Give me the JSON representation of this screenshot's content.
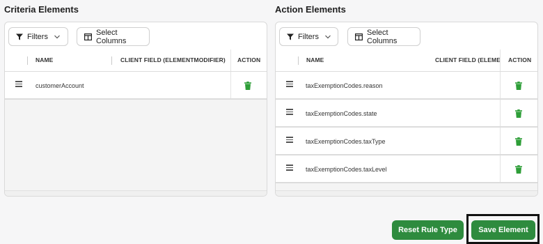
{
  "criteria": {
    "title": "Criteria Elements",
    "filters_label": "Filters",
    "select_columns_label": "Select Columns",
    "columns": {
      "name": "NAME",
      "client_field": "CLIENT FIELD (ELEMENTMODIFIER)",
      "action": "ACTION"
    },
    "rows": [
      {
        "name": "customerAccount"
      }
    ]
  },
  "actions_panel": {
    "title": "Action Elements",
    "filters_label": "Filters",
    "select_columns_label": "Select Columns",
    "columns": {
      "name": "NAME",
      "client_field": "CLIENT FIELD (ELEMENTMODIFIER)",
      "action": "ACTION"
    },
    "rows": [
      {
        "name": "taxExemptionCodes.reason"
      },
      {
        "name": "taxExemptionCodes.state"
      },
      {
        "name": "taxExemptionCodes.taxType"
      },
      {
        "name": "taxExemptionCodes.taxLevel"
      }
    ]
  },
  "footer": {
    "reset_label": "Reset Rule Type",
    "save_label": "Save Element"
  },
  "colors": {
    "accent_green": "#2e8b3e",
    "trash_green": "#2e9e38"
  },
  "icons": [
    "filter-icon",
    "chevron-down-icon",
    "columns-icon",
    "drag-handle-icon",
    "trash-icon"
  ]
}
